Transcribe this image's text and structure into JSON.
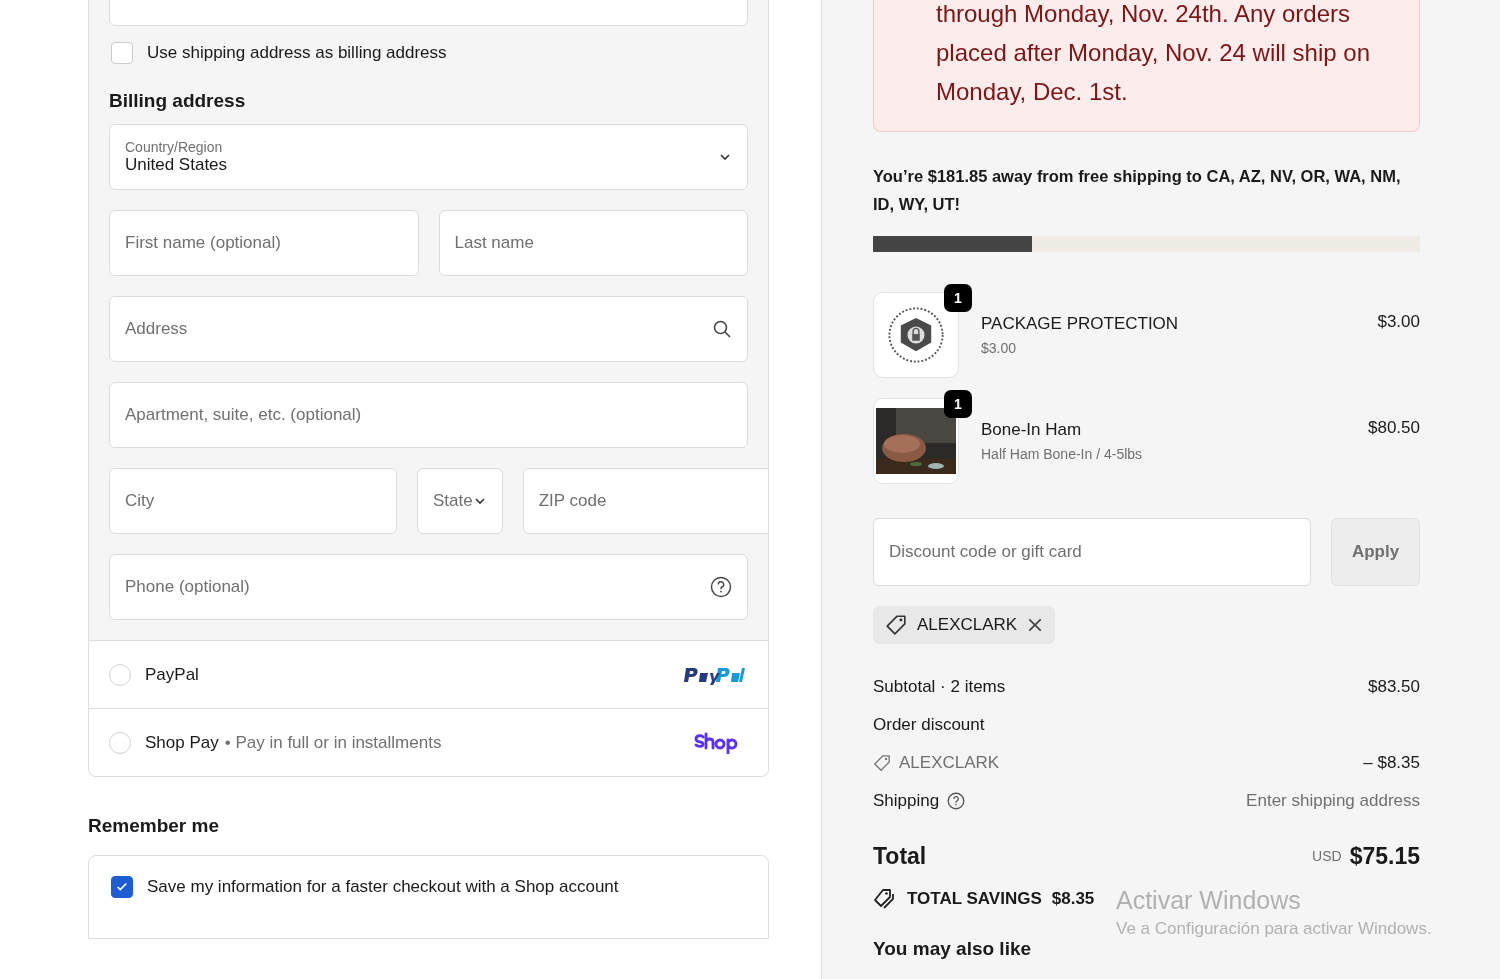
{
  "billing_toggle": {
    "label": "Use shipping address as billing address",
    "checked": false
  },
  "billing": {
    "heading": "Billing address",
    "country": {
      "label": "Country/Region",
      "value": "United States"
    },
    "field_rows": [
      [
        {
          "kind": "text",
          "placeholder": "First name (optional)"
        },
        {
          "kind": "text",
          "placeholder": "Last name"
        }
      ],
      [
        {
          "kind": "search",
          "placeholder": "Address"
        }
      ],
      [
        {
          "kind": "text",
          "placeholder": "Apartment, suite, etc. (optional)"
        }
      ],
      [
        {
          "kind": "text",
          "placeholder": "City"
        },
        {
          "kind": "select",
          "placeholder": "State"
        },
        {
          "kind": "text",
          "placeholder": "ZIP code"
        }
      ],
      [
        {
          "kind": "help",
          "placeholder": "Phone (optional)"
        }
      ]
    ]
  },
  "payment_methods": [
    {
      "kind": "paypal",
      "label": "PayPal",
      "selected": false
    },
    {
      "kind": "shop",
      "label": "Shop Pay",
      "note": "• Pay in full or in installments",
      "selected": false
    }
  ],
  "remember": {
    "heading": "Remember me",
    "label": "Save my information for a faster checkout with a Shop account",
    "checked": true
  },
  "notice": {
    "text": "through Monday, Nov. 24th. Any orders placed after Monday, Nov. 24 will ship on Monday, Dec. 1st."
  },
  "free_shipping": {
    "text": "You’re $181.85 away from free shipping to CA, AZ, NV, OR, WA, NM, ID, WY, UT!",
    "level": 0.29
  },
  "cart": [
    {
      "kind": "protection",
      "quantity": "1",
      "name": "PACKAGE PROTECTION",
      "variant": "$3.00",
      "price": "$3.00"
    },
    {
      "kind": "picture",
      "quantity": "1",
      "name": "Bone-In Ham",
      "variant": "Half Ham Bone-In / 4-5lbs",
      "price": "$80.50"
    }
  ],
  "discount": {
    "placeholder": "Discount code or gift card",
    "button": "Apply",
    "applied_code": "ALEXCLARK"
  },
  "summary": {
    "subtotal_label": "Subtotal · 2 items",
    "subtotal": "$83.50",
    "discount_label": "Order discount",
    "discount_code": "ALEXCLARK",
    "discount_amount": "– $8.35",
    "shipping_label": "Shipping",
    "shipping_value": "Enter shipping address",
    "total_label": "Total",
    "currency": "USD",
    "total": "$75.15",
    "savings_label": "TOTAL SAVINGS",
    "savings": "$8.35"
  },
  "also_like": "You may also like",
  "os_watermark": {
    "title": "Activar Windows",
    "subtitle": "Ve a Configuración para activar Windows."
  }
}
